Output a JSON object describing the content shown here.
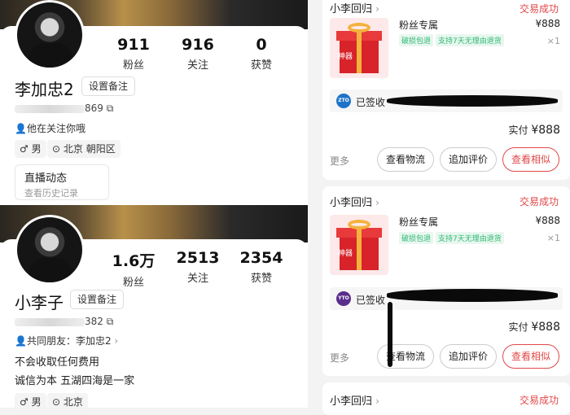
{
  "profiles": [
    {
      "name": "李加忠2",
      "remark_button": "设置备注",
      "uid_suffix": "869",
      "copy_icon": "⧉",
      "relation": "他在关注你哦",
      "relation_icon": "person-icon",
      "followers": {
        "value": "911",
        "label": "粉丝"
      },
      "following": {
        "value": "916",
        "label": "关注"
      },
      "likes": {
        "value": "0",
        "label": "获赞"
      },
      "gender": "♂ 男",
      "location": "北京 朝阳区",
      "live": {
        "title": "直播动态",
        "subtitle": "查看历史记录"
      }
    },
    {
      "name": "小李子",
      "remark_button": "设置备注",
      "uid_suffix": "382",
      "copy_icon": "⧉",
      "relation": "共同朋友：李加忠2",
      "relation_icon": "person-icon",
      "followers": {
        "value": "1.6万",
        "label": "粉丝"
      },
      "following": {
        "value": "2513",
        "label": "关注"
      },
      "likes": {
        "value": "2354",
        "label": "获赞"
      },
      "bio_line1": "不会收取任何费用",
      "bio_line2": "诚信为本   五湖四海是一家",
      "gender": "♂ 男",
      "location": "北京"
    }
  ],
  "orders": [
    {
      "shop": "小李回归",
      "status": "交易成功",
      "product_title": "粉丝专属",
      "gift_word": "神器",
      "chips": [
        "破损包退",
        "支持7天无理由退货"
      ],
      "price": "¥888",
      "qty": "×1",
      "ship_logo": "ZTO",
      "ship_logo_color": "#1e73c8",
      "ship_status": "已签收",
      "total_label": "实付",
      "total": "¥888",
      "more": "更多",
      "btn_logistics": "查看物流",
      "btn_review": "追加评价",
      "btn_similar": "查看相似"
    },
    {
      "shop": "小李回归",
      "status": "交易成功",
      "product_title": "粉丝专属",
      "gift_word": "神器",
      "chips": [
        "破损包退",
        "支持7天无理由退货"
      ],
      "price": "¥888",
      "qty": "×1",
      "ship_logo": "YTO",
      "ship_logo_color": "#5a2d8c",
      "ship_status": "已签收",
      "total_label": "实付",
      "total": "¥888",
      "more": "更多",
      "btn_logistics": "查看物流",
      "btn_review": "追加评价",
      "btn_similar": "查看相似"
    },
    {
      "shop": "小李回归",
      "status": "交易成功"
    }
  ],
  "colors": {
    "accent_red": "#e04848",
    "chip_green": "#2eb872"
  }
}
